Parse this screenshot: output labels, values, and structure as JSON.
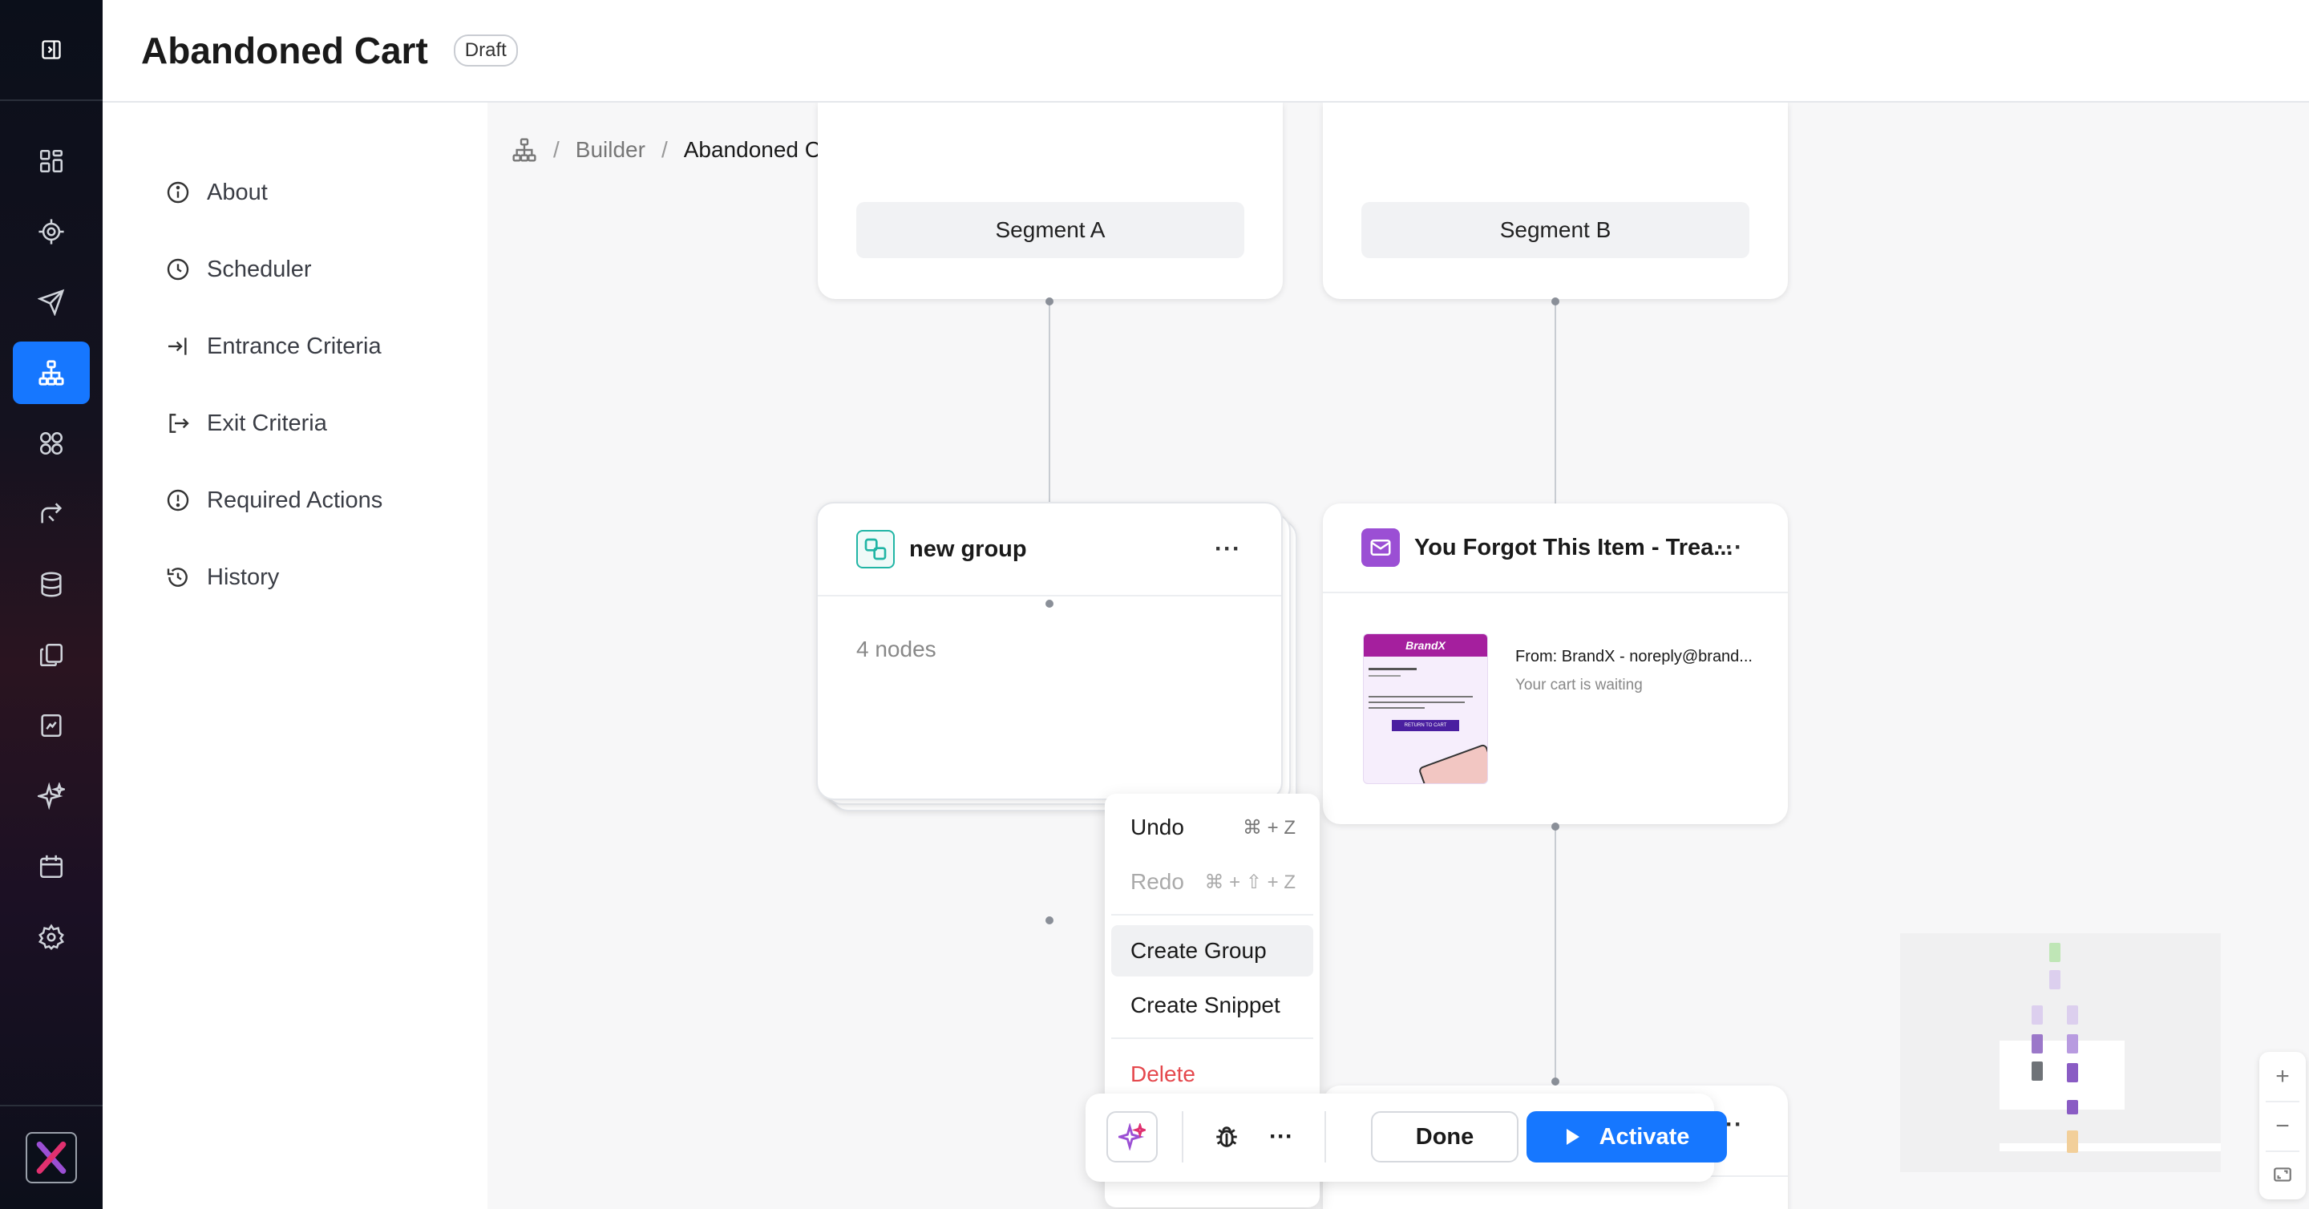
{
  "app": {
    "title": "Abandoned Cart",
    "status_badge": "Draft"
  },
  "rail": {
    "active_index": 3,
    "icons": [
      "dashboard-icon",
      "target-icon",
      "send-icon",
      "hierarchy-icon",
      "segments-icon",
      "journey-icon",
      "database-icon",
      "copy-icon",
      "report-icon",
      "sparkle-icon",
      "calendar-icon",
      "settings-icon"
    ]
  },
  "sidebar": {
    "items": [
      {
        "label": "About",
        "icon": "info-icon"
      },
      {
        "label": "Scheduler",
        "icon": "clock-icon"
      },
      {
        "label": "Entrance Criteria",
        "icon": "enter-icon"
      },
      {
        "label": "Exit Criteria",
        "icon": "exit-icon"
      },
      {
        "label": "Required Actions",
        "icon": "alert-icon"
      },
      {
        "label": "History",
        "icon": "history-icon"
      }
    ]
  },
  "breadcrumb": {
    "items": [
      "Builder",
      "Abandoned Cart"
    ],
    "separator": "/"
  },
  "canvas": {
    "segment_a": "Segment A",
    "segment_b": "Segment B",
    "group_node": {
      "title": "new group",
      "body": "4 nodes",
      "menu": "···"
    },
    "email_node": {
      "title": "You Forgot This Item - Trea...",
      "from": "From: BrandX - noreply@brand...",
      "subject": "Your cart is waiting",
      "menu": "···",
      "preview_brand": "BrandX",
      "preview_cta": "RETURN TO CART"
    },
    "bottom_node_menu": "···"
  },
  "context_menu": {
    "undo": {
      "label": "Undo",
      "shortcut": "⌘ + Z"
    },
    "redo": {
      "label": "Redo",
      "shortcut": "⌘ + ⇧ + Z"
    },
    "create_group": "Create Group",
    "create_snippet": "Create Snippet",
    "delete": "Delete"
  },
  "toolbar": {
    "more": "···",
    "done": "Done",
    "activate": "Activate"
  },
  "zoom": {
    "plus": "+",
    "minus": "−"
  },
  "colors": {
    "accent": "#1677ff",
    "danger": "#e5484d",
    "group_teal": "#21b5a5",
    "email_purple": "#9b4fd4"
  }
}
